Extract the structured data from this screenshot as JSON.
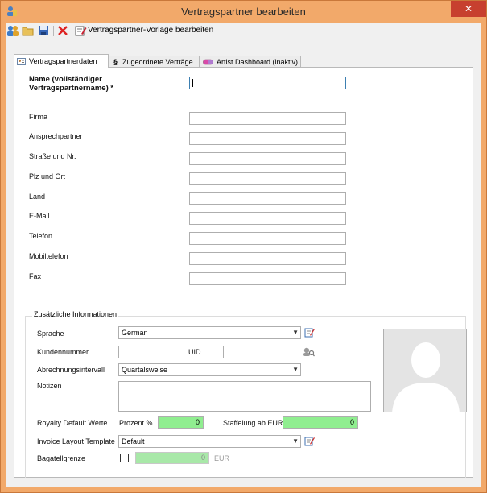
{
  "window": {
    "title": "Vertragspartner bearbeiten",
    "close_glyph": "✕"
  },
  "toolbar": {
    "icons": [
      "users-icon",
      "folder-open-icon",
      "save-icon",
      "delete-icon",
      "edit-template-icon"
    ],
    "template_label": "Vertragspartner-Vorlage bearbeiten"
  },
  "tabs": [
    {
      "label": "Vertragspartnerdaten",
      "icon": "contact-card-icon",
      "active": true
    },
    {
      "label": "Zugeordnete Verträge",
      "icon": "paragraph-icon",
      "glyph": "§",
      "active": false
    },
    {
      "label": "Artist Dashboard (inaktiv)",
      "icon": "pill-icon",
      "active": false
    }
  ],
  "form": {
    "name_label": "Name (vollständiger Vertragspartnername) *",
    "name_value": "",
    "fields": [
      {
        "label": "Firma",
        "value": ""
      },
      {
        "label": "Ansprechpartner",
        "value": ""
      },
      {
        "label": "Straße und Nr.",
        "value": ""
      },
      {
        "label": "Plz und Ort",
        "value": ""
      },
      {
        "label": "Land",
        "value": ""
      },
      {
        "label": "E-Mail",
        "value": ""
      },
      {
        "label": "Telefon",
        "value": ""
      },
      {
        "label": "Mobiltelefon",
        "value": ""
      },
      {
        "label": "Fax",
        "value": ""
      }
    ]
  },
  "extra": {
    "group_title": "Zusätzliche Informationen",
    "language_label": "Sprache",
    "language_value": "German",
    "customer_no_label": "Kundennummer",
    "customer_no_value": "",
    "uid_label": "UID",
    "uid_value": "",
    "billing_label": "Abrechnungsintervall",
    "billing_value": "Quartalsweise",
    "notes_label": "Notizen",
    "notes_value": "",
    "royalty_label": "Royalty Default Werte",
    "percent_label": "Prozent %",
    "percent_value": "0",
    "tier_label": "Staffelung ab EUR",
    "tier_value": "0",
    "invoice_label": "Invoice Layout Template",
    "invoice_value": "Default",
    "petty_label": "Bagatellgrenze",
    "petty_checked": false,
    "petty_value": "0",
    "petty_unit": "EUR"
  },
  "colors": {
    "titlebar": "#f2a96a",
    "close_button": "#c7402f",
    "numeric_field": "#90ee90",
    "focus_border": "#3c7fb1"
  }
}
